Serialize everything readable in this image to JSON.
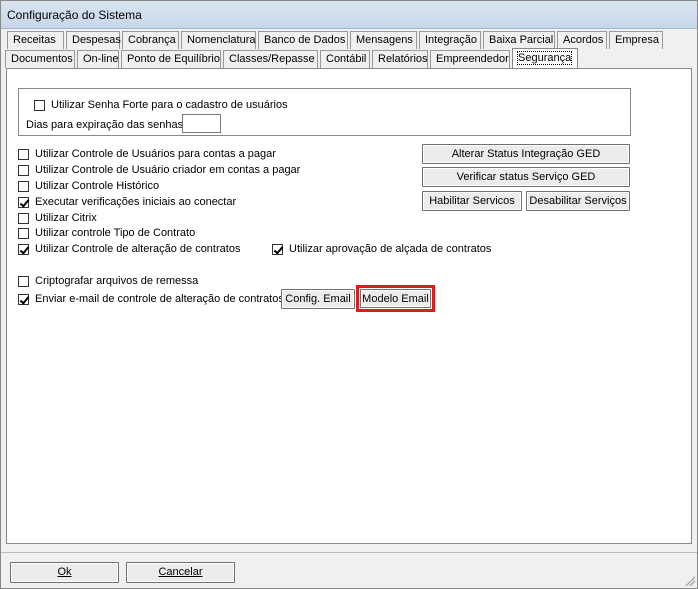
{
  "window": {
    "title": "Configuração do Sistema"
  },
  "tabs_row1": [
    "Receitas",
    "Despesas",
    "Cobrança",
    "Nomenclatura",
    "Banco de Dados",
    "Mensagens",
    "Integração",
    "Baixa Parcial",
    "Acordos",
    "Empresa"
  ],
  "tabs_row2": [
    "Documentos",
    "On-line",
    "Ponto de Equilíbrio",
    "Classes/Repasse",
    "Contábil",
    "Relatórios",
    "Empreendedor",
    "Segurança"
  ],
  "active_tab": "Segurança",
  "password_group": {
    "strong_password_label": "Utilizar Senha Forte para o cadastro de usuários",
    "strong_password_checked": false,
    "expiration_label": "Dias para expiração das senhas:",
    "expiration_value": ""
  },
  "options": [
    {
      "label": "Utilizar Controle de Usuários para contas a pagar",
      "checked": false
    },
    {
      "label": "Utilizar Controle de Usuário criador em contas a pagar",
      "checked": false
    },
    {
      "label": "Utilizar Controle Histórico",
      "checked": false
    },
    {
      "label": "Executar verificações iniciais ao conectar",
      "checked": true
    },
    {
      "label": "Utilizar Citrix",
      "checked": false
    },
    {
      "label": "Utilizar controle Tipo de Contrato",
      "checked": false
    },
    {
      "label": "Utilizar Controle de alteração de contratos",
      "checked": true
    }
  ],
  "approval_option": {
    "label": "Utilizar aprovação de alçada de contratos",
    "checked": true
  },
  "encrypt_option": {
    "label": "Criptografar arquivos de remessa",
    "checked": false
  },
  "email_option": {
    "label": "Enviar e-mail de controle de alteração de contratos",
    "checked": true
  },
  "buttons": {
    "alter_ged": "Alterar Status Integração GED",
    "verify_ged": "Verificar status Serviço GED",
    "enable_services": "Habilitar Servicos",
    "disable_services": "Desabilitar Serviços",
    "config_email": "Config. Email",
    "email_template": "Modelo Email",
    "ok": "Ok",
    "cancel": "Cancelar"
  },
  "highlight_color": "#e01b1b"
}
